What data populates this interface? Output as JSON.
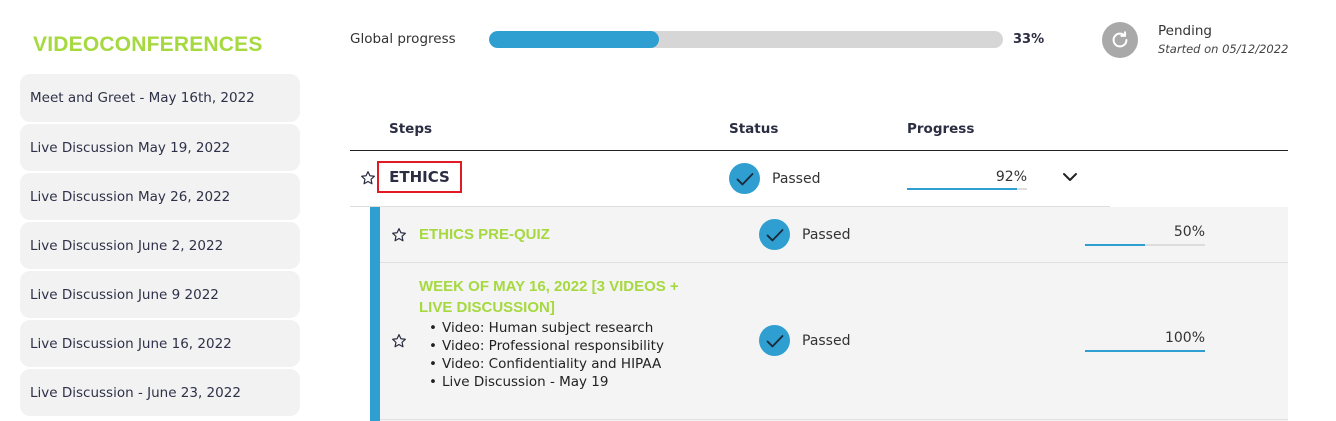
{
  "sidebar": {
    "title": "VIDEOCONFERENCES",
    "items": [
      {
        "label": "Meet and Greet - May 16th, 2022"
      },
      {
        "label": "Live Discussion May 19, 2022"
      },
      {
        "label": "Live Discussion May 26, 2022"
      },
      {
        "label": "Live Discussion June 2, 2022"
      },
      {
        "label": "Live Discussion June 9 2022"
      },
      {
        "label": "Live Discussion June 16, 2022"
      },
      {
        "label": "Live Discussion - June 23, 2022"
      }
    ]
  },
  "global_progress": {
    "label": "Global progress",
    "percent_text": "33%",
    "value": 0.33
  },
  "status": {
    "label": "Pending",
    "started": "Started on 05/12/2022",
    "icon": "refresh-icon"
  },
  "table": {
    "headers": {
      "steps": "Steps",
      "status": "Status",
      "progress": "Progress"
    },
    "main_step": {
      "title": "ETHICS",
      "status": "Passed",
      "progress_text": "92%",
      "progress_value": 0.92
    },
    "sub_steps": [
      {
        "title_lines": [
          "ETHICS PRE-QUIZ"
        ],
        "status": "Passed",
        "progress_text": "50%",
        "progress_value": 0.5,
        "bullets": []
      },
      {
        "title_lines": [
          "WEEK OF MAY 16, 2022 [3 VIDEOS +",
          "LIVE DISCUSSION]"
        ],
        "status": "Passed",
        "progress_text": "100%",
        "progress_value": 1.0,
        "bullets": [
          "Video: Human subject research",
          "Video: Professional responsibility",
          "Video: Confidentiality and HIPAA",
          "Live Discussion - May 19"
        ]
      }
    ]
  },
  "colors": {
    "accent_green": "#a6d93f",
    "accent_blue": "#2e9fd0",
    "highlight_red": "#e01b24"
  }
}
